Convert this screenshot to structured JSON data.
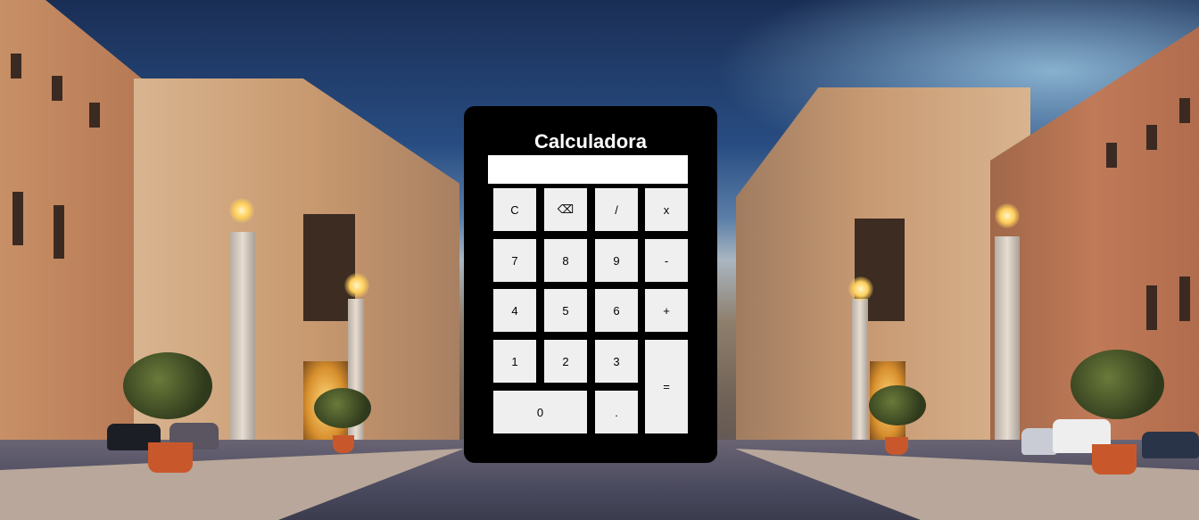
{
  "calculator": {
    "title": "Calculadora",
    "display_value": "",
    "keys": {
      "clear": "C",
      "backspace": "⌫",
      "divide": "/",
      "multiply": "x",
      "seven": "7",
      "eight": "8",
      "nine": "9",
      "subtract": "-",
      "four": "4",
      "five": "5",
      "six": "6",
      "add": "+",
      "one": "1",
      "two": "2",
      "three": "3",
      "equals": "=",
      "zero": "0",
      "decimal": "."
    }
  },
  "colors": {
    "panel": "#000000",
    "key": "#efefef",
    "display": "#ffffff",
    "title": "#ffffff"
  }
}
